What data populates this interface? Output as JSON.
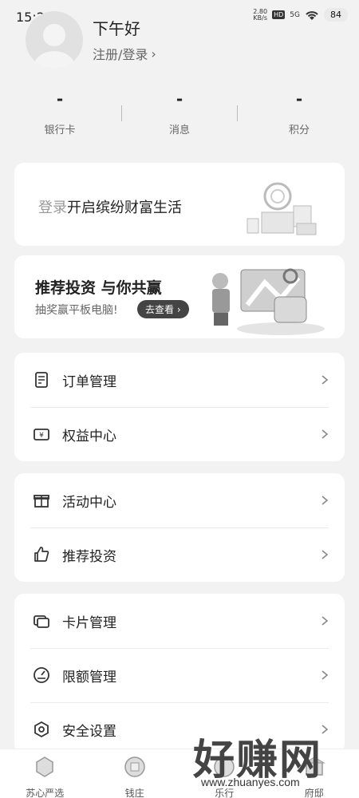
{
  "status": {
    "time": "15:28",
    "net_speed_top": "2.80",
    "net_speed_bottom": "KB/s",
    "hd": "HD",
    "signal": "5G",
    "battery": "84"
  },
  "profile": {
    "greeting": "下午好",
    "register": "注册/登录",
    "chevron": "›"
  },
  "stats": [
    {
      "value": "-",
      "label": "银行卡"
    },
    {
      "value": "-",
      "label": "消息"
    },
    {
      "value": "-",
      "label": "积分"
    }
  ],
  "login_banner": {
    "muted": "登录",
    "text": "开启缤纷财富生活"
  },
  "promo": {
    "title": "推荐投资 与你共赢",
    "subtitle": "抽奖赢平板电脑!",
    "button": "去查看 ›"
  },
  "menu_groups": [
    [
      {
        "label": "订单管理",
        "icon": "order-icon"
      },
      {
        "label": "权益中心",
        "icon": "benefit-icon"
      }
    ],
    [
      {
        "label": "活动中心",
        "icon": "gift-icon"
      },
      {
        "label": "推荐投资",
        "icon": "thumbs-up-icon"
      }
    ],
    [
      {
        "label": "卡片管理",
        "icon": "card-icon"
      },
      {
        "label": "限额管理",
        "icon": "gauge-icon"
      },
      {
        "label": "安全设置",
        "icon": "shield-icon"
      }
    ]
  ],
  "bottom_nav": [
    {
      "label": "苏心严选"
    },
    {
      "label": "钱庄"
    },
    {
      "label": "乐行"
    },
    {
      "label": "府邸"
    }
  ],
  "watermark": {
    "big": "好赚网",
    "small": "www.zhuanyes.com"
  }
}
